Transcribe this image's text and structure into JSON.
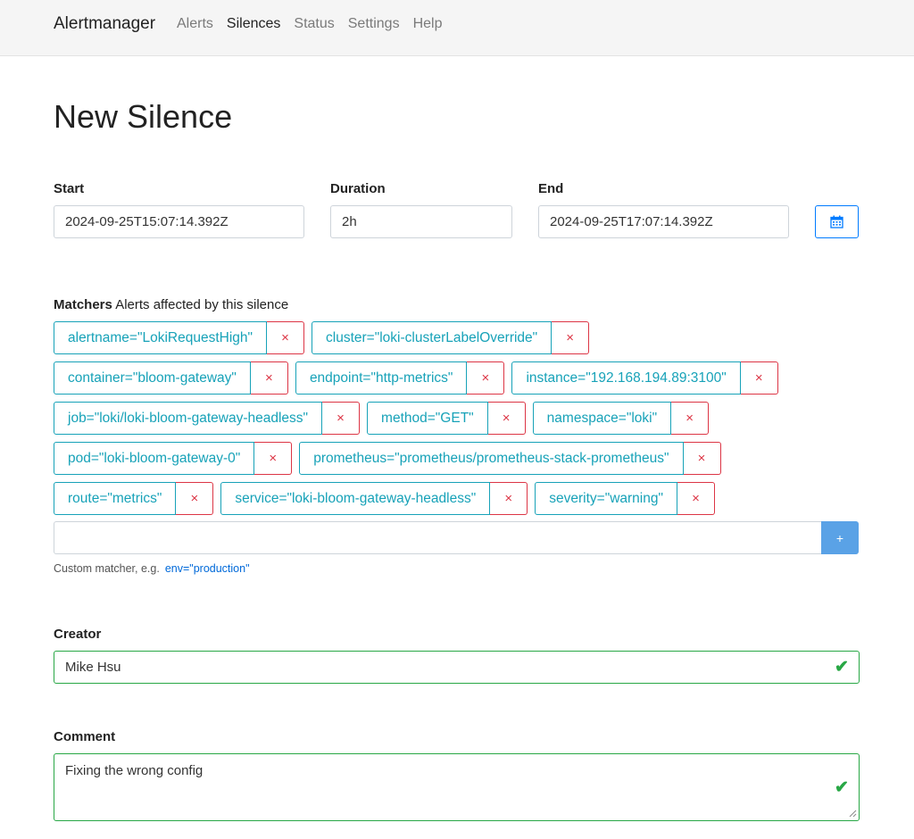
{
  "nav": {
    "brand": "Alertmanager",
    "links": [
      {
        "label": "Alerts",
        "active": false
      },
      {
        "label": "Silences",
        "active": true
      },
      {
        "label": "Status",
        "active": false
      },
      {
        "label": "Settings",
        "active": false
      },
      {
        "label": "Help",
        "active": false
      }
    ]
  },
  "page": {
    "title": "New Silence"
  },
  "form": {
    "start": {
      "label": "Start",
      "value": "2024-09-25T15:07:14.392Z"
    },
    "duration": {
      "label": "Duration",
      "value": "2h"
    },
    "end": {
      "label": "End",
      "value": "2024-09-25T17:07:14.392Z"
    },
    "calendar_icon": "calendar-icon",
    "matchers": {
      "heading": "Matchers",
      "subheading": "Alerts affected by this silence",
      "remove_symbol": "×",
      "rows": [
        [
          "alertname=\"LokiRequestHigh\"",
          "cluster=\"loki-clusterLabelOverride\""
        ],
        [
          "container=\"bloom-gateway\"",
          "endpoint=\"http-metrics\"",
          "instance=\"192.168.194.89:3100\""
        ],
        [
          "job=\"loki/loki-bloom-gateway-headless\"",
          "method=\"GET\"",
          "namespace=\"loki\""
        ],
        [
          "pod=\"loki-bloom-gateway-0\"",
          "prometheus=\"prometheus/prometheus-stack-prometheus\""
        ],
        [
          "route=\"metrics\"",
          "service=\"loki-bloom-gateway-headless\"",
          "severity=\"warning\""
        ]
      ],
      "custom_value": "",
      "add_label": "+",
      "hint_text": "Custom matcher, e.g.",
      "hint_example": "env=\"production\""
    },
    "creator": {
      "label": "Creator",
      "value": "Mike Hsu"
    },
    "comment": {
      "label": "Comment",
      "value": "Fixing the wrong config"
    },
    "check_symbol": "✔",
    "colors": {
      "accent": "#007bff",
      "matcher": "#17a2b8",
      "remove": "#dc3545",
      "valid": "#28a745",
      "add_button": "#5aa2e6"
    }
  }
}
